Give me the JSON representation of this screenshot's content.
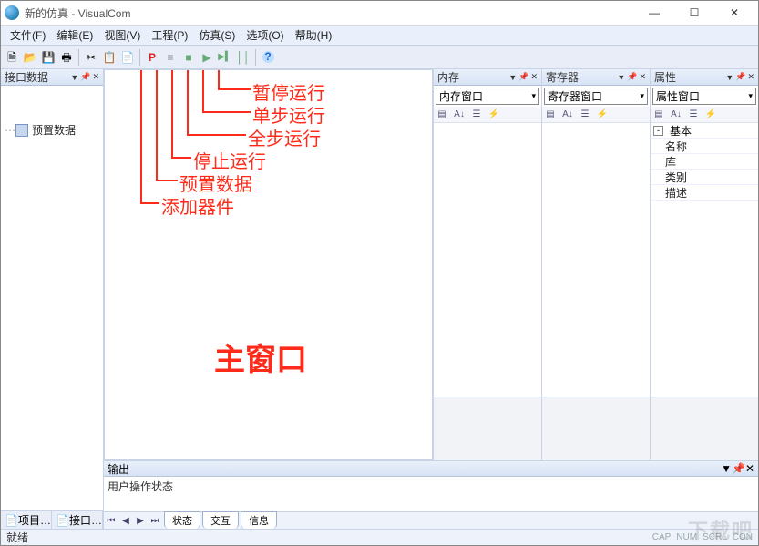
{
  "window": {
    "title": "新的仿真 - VisualCom"
  },
  "menus": {
    "file": "文件(F)",
    "edit": "编辑(E)",
    "view": "视图(V)",
    "project": "工程(P)",
    "sim": "仿真(S)",
    "options": "选项(O)",
    "help": "帮助(H)"
  },
  "toolbar_icons": {
    "new": "🗎",
    "open": "📂",
    "save": "💾",
    "print": "🖶",
    "cut": "✂",
    "copy": "📋",
    "paste": "📄",
    "add_device": "P",
    "preset": "≡",
    "stop": "■",
    "run_all": "▶",
    "step": "▶▍",
    "pause": "││",
    "help": "?"
  },
  "left_panel": {
    "title": "接口数据",
    "item": "预置数据",
    "tabs": {
      "project": "项目…",
      "port": "接口…"
    }
  },
  "right": {
    "mem": {
      "title": "内存",
      "dropdown": "内存窗口"
    },
    "reg": {
      "title": "寄存器",
      "dropdown": "寄存器窗口"
    },
    "prop": {
      "title": "属性",
      "dropdown": "属性窗口",
      "group": "基本",
      "rows": {
        "name": "名称",
        "lib": "库",
        "cat": "类别",
        "desc": "描述"
      }
    }
  },
  "output": {
    "title": "输出",
    "body": "用户操作状态",
    "tabs": {
      "status": "状态",
      "interact": "交互",
      "info": "信息"
    }
  },
  "status": {
    "ready": "就绪",
    "cap": "CAP",
    "num": "NUM",
    "scrl": "SCRL",
    "con": "CON"
  },
  "annotations": {
    "pause": "暂停运行",
    "step": "单步运行",
    "runall": "全步运行",
    "stop": "停止运行",
    "preset": "预置数据",
    "add": "添加器件",
    "mainwin": "主窗口"
  },
  "watermark": "下载吧"
}
